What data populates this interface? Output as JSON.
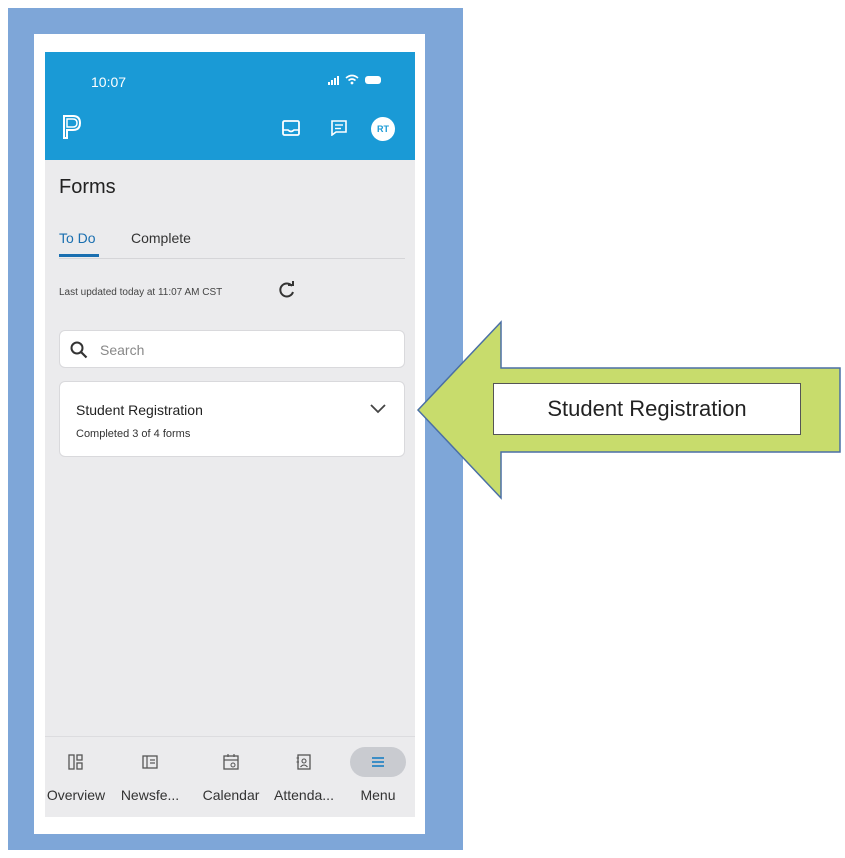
{
  "status_bar": {
    "time": "10:07"
  },
  "header": {
    "avatar_initials": "RT"
  },
  "page": {
    "title": "Forms"
  },
  "tabs": [
    {
      "label": "To Do",
      "active": true
    },
    {
      "label": "Complete",
      "active": false
    }
  ],
  "last_updated": "Last updated today at 11:07 AM CST",
  "search": {
    "placeholder": "Search"
  },
  "form_card": {
    "title": "Student Registration",
    "subtitle": "Completed 3 of 4 forms"
  },
  "bottom_nav": [
    {
      "label": "Overview",
      "icon": "overview-icon"
    },
    {
      "label": "Newsfe...",
      "icon": "newsfeed-icon"
    },
    {
      "label": "Calendar",
      "icon": "calendar-icon"
    },
    {
      "label": "Attenda...",
      "icon": "attendance-icon"
    },
    {
      "label": "Menu",
      "icon": "menu-icon",
      "active": true
    }
  ],
  "callout": {
    "label": "Student Registration"
  },
  "colors": {
    "header_bg": "#1a9ad6",
    "frame_blue": "#7ea6d8",
    "arrow_fill": "#c8dc6c",
    "arrow_stroke": "#4a6fa5"
  }
}
